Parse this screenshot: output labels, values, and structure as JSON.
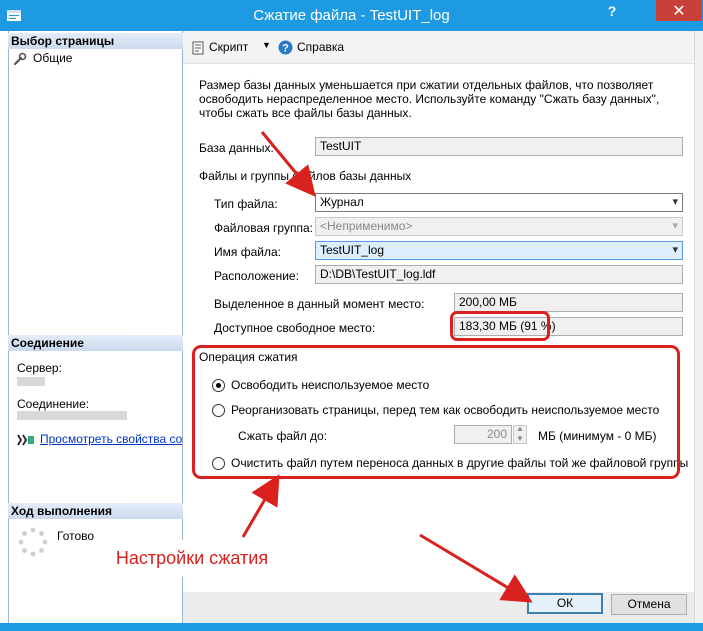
{
  "window": {
    "title": "Сжатие файла - TestUIT_log",
    "help_glyph": "?",
    "close_glyph": "✕"
  },
  "left_pane": {
    "select_page_header": "Выбор страницы",
    "pages": [
      {
        "label": "Общие",
        "icon": "wrench-icon"
      }
    ],
    "connection_header": "Соединение",
    "server_label": "Сервер:",
    "connection_label": "Соединение:",
    "view_props_link": "Просмотреть свойства соед",
    "progress_header": "Ход выполнения",
    "progress_status": "Готово"
  },
  "toolbar": {
    "script_label": "Скрипт",
    "help_label": "Справка"
  },
  "content": {
    "description": "Размер базы данных уменьшается при сжатии отдельных файлов, что позволяет освободить нераспределенное место. Используйте команду \"Сжать базу данных\", чтобы сжать все файлы базы данных.",
    "database_label": "База данных:",
    "database_value": "TestUIT",
    "files_group_label": "Файлы и группы файлов базы данных",
    "file_type_label": "Тип файла:",
    "file_type_value": "Журнал",
    "filegroup_label": "Файловая группа:",
    "filegroup_value": "<Неприменимо>",
    "file_name_label": "Имя файла:",
    "file_name_value": "TestUIT_log",
    "location_label": "Расположение:",
    "location_value": "D:\\DB\\TestUIT_log.ldf",
    "allocated_label": "Выделенное в данный момент место:",
    "allocated_value": "200,00 МБ",
    "free_label": "Доступное свободное место:",
    "free_value": "183,30 МБ (91 %)"
  },
  "shrink_action": {
    "title": "Операция сжатия",
    "options": [
      {
        "label": "Освободить неиспользуемое место",
        "checked": true
      },
      {
        "label": "Реорганизовать страницы, перед тем как освободить неиспользуемое место",
        "checked": false
      },
      {
        "label": "Очистить файл путем переноса данных в другие файлы той же файловой группы",
        "checked": false
      }
    ],
    "shrink_to_label": "Сжать файл до:",
    "shrink_to_value": "200",
    "shrink_to_unit": "МБ (минимум - 0 МБ)"
  },
  "annotation": {
    "label": "Настройки сжатия",
    "color": "#d9211e"
  },
  "buttons": {
    "ok": "ОК",
    "cancel": "Отмена"
  },
  "colors": {
    "titlebar": "#1e9ae3",
    "close": "#c7403a",
    "link": "#0033cc"
  }
}
